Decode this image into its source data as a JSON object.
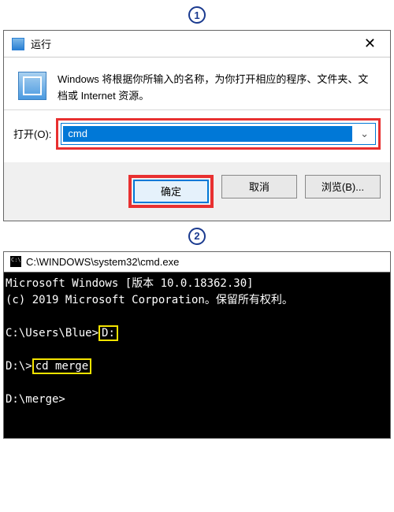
{
  "badges": {
    "one": "1",
    "two": "2"
  },
  "run": {
    "title": "运行",
    "description": "Windows 将根据你所输入的名称，为你打开相应的程序、文件夹、文档或 Internet 资源。",
    "open_label": "打开(O):",
    "input_value": "cmd",
    "ok_label": "确定",
    "cancel_label": "取消",
    "browse_label": "浏览(B)..."
  },
  "cmd": {
    "title": "C:\\WINDOWS\\system32\\cmd.exe",
    "line1": "Microsoft Windows [版本 10.0.18362.30]",
    "line2": "(c) 2019 Microsoft Corporation。保留所有权利。",
    "prompt1_pre": "C:\\Users\\Blue>",
    "cmd1": "D:",
    "prompt2_pre": "D:\\>",
    "cmd2": "cd merge",
    "prompt3": "D:\\merge>"
  }
}
